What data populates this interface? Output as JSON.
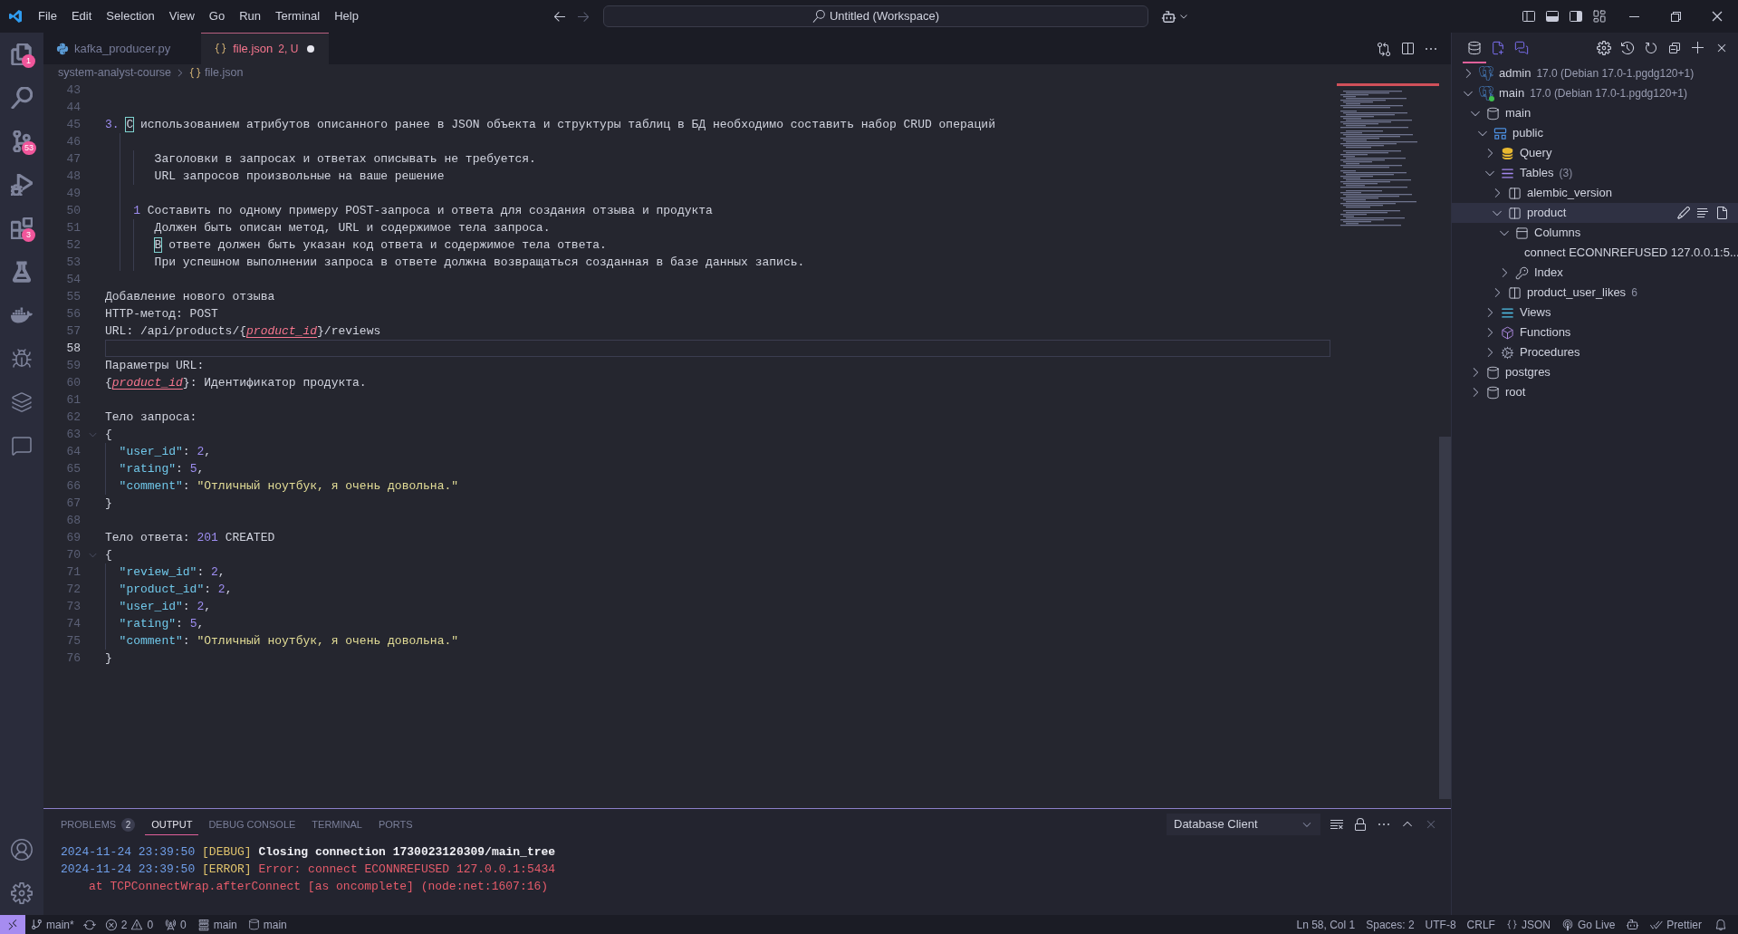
{
  "title_bar": {
    "menu": [
      "File",
      "Edit",
      "Selection",
      "View",
      "Go",
      "Run",
      "Terminal",
      "Help"
    ],
    "command_center": "Untitled (Workspace)"
  },
  "activity_bar": {
    "explorer_badge": "1",
    "source_control_badge": "53",
    "extensions_badge": "3"
  },
  "editor_tabs": [
    {
      "label": "kafka_producer.py",
      "kind": "python",
      "selected": false,
      "has_problems": false,
      "modified": false
    },
    {
      "label": "file.json",
      "kind": "json",
      "status": "2, U",
      "selected": true,
      "has_problems": true,
      "modified": true
    }
  ],
  "breadcrumb": [
    {
      "label": "system-analyst-course",
      "kind": "folder"
    },
    {
      "label": "file.json",
      "kind": "json"
    }
  ],
  "editor": {
    "lines": [
      {
        "number": "43",
        "current": false,
        "fold_marker": false
      },
      {
        "number": "44",
        "current": false,
        "fold_marker": false
      },
      {
        "number": "45",
        "current": false,
        "fold_marker": false,
        "segments": [
          {
            "kind": "number",
            "text": "3. "
          },
          {
            "kind": "highlighted",
            "text": "С"
          },
          {
            "kind": "text",
            "text": " использованием атрибутов описанного ранее в JSON объекта и структуры таблиц в БД необходимо составить набор CRUD операций"
          }
        ]
      },
      {
        "number": "46",
        "current": false,
        "fold_marker": false
      },
      {
        "number": "47",
        "current": false,
        "fold_marker": false,
        "segments": [
          {
            "kind": "text",
            "text": "       Заголовки в запросах и ответах описывать не требуется."
          }
        ]
      },
      {
        "number": "48",
        "current": false,
        "fold_marker": false,
        "segments": [
          {
            "kind": "text",
            "text": "       URL запросов произвольные на ваше решение"
          }
        ]
      },
      {
        "number": "49",
        "current": false,
        "fold_marker": false
      },
      {
        "number": "50",
        "current": false,
        "fold_marker": false,
        "segments": [
          {
            "kind": "number",
            "text": "    1"
          },
          {
            "kind": "text",
            "text": " Составить по одному примеру POST-запроса и ответа для создания отзыва и продукта"
          }
        ]
      },
      {
        "number": "51",
        "current": false,
        "fold_marker": false,
        "segments": [
          {
            "kind": "text",
            "text": "       Должен быть описан метод, URL и содержимое тела запроса."
          }
        ]
      },
      {
        "number": "52",
        "current": false,
        "fold_marker": false,
        "segments": [
          {
            "kind": "highlighted",
            "text": "       В"
          },
          {
            "kind": "text",
            "text": " ответе должен быть указан код ответа и содержимое тела ответа."
          }
        ]
      },
      {
        "number": "53",
        "current": false,
        "fold_marker": false,
        "segments": [
          {
            "kind": "text",
            "text": "       При успешном выполнении запроса в ответе должна возвращаться созданная в базе данных запись."
          }
        ]
      },
      {
        "number": "54",
        "current": false,
        "fold_marker": false
      },
      {
        "number": "55",
        "current": false,
        "fold_marker": false,
        "segments": [
          {
            "kind": "text",
            "text": "Добавление нового отзыва"
          }
        ]
      },
      {
        "number": "56",
        "current": false,
        "fold_marker": false,
        "segments": [
          {
            "kind": "text",
            "text": "HTTP-метод: POST"
          }
        ]
      },
      {
        "number": "57",
        "current": false,
        "fold_marker": false,
        "segments": [
          {
            "kind": "text",
            "text": "URL: /api/products/{"
          },
          {
            "kind": "error",
            "text": "product_id"
          },
          {
            "kind": "text",
            "text": "}/reviews"
          }
        ]
      },
      {
        "number": "58",
        "current": true,
        "fold_marker": false
      },
      {
        "number": "59",
        "current": false,
        "fold_marker": false,
        "segments": [
          {
            "kind": "text",
            "text": "Параметры URL:"
          }
        ]
      },
      {
        "number": "60",
        "current": false,
        "fold_marker": false,
        "segments": [
          {
            "kind": "text",
            "text": "{"
          },
          {
            "kind": "error",
            "text": "product_id"
          },
          {
            "kind": "text",
            "text": "}: Идентификатор продукта."
          }
        ]
      },
      {
        "number": "61",
        "current": false,
        "fold_marker": false
      },
      {
        "number": "62",
        "current": false,
        "fold_marker": false,
        "segments": [
          {
            "kind": "text",
            "text": "Тело запроса:"
          }
        ]
      },
      {
        "number": "63",
        "current": false,
        "fold_marker": true,
        "segments": [
          {
            "kind": "text",
            "text": "{"
          }
        ]
      },
      {
        "number": "64",
        "current": false,
        "fold_marker": false,
        "segments": [
          {
            "kind": "key",
            "text": "  \"user_id\""
          },
          {
            "kind": "text",
            "text": ": "
          },
          {
            "kind": "number",
            "text": "2"
          },
          {
            "kind": "text",
            "text": ","
          }
        ]
      },
      {
        "number": "65",
        "current": false,
        "fold_marker": false,
        "segments": [
          {
            "kind": "key",
            "text": "  \"rating\""
          },
          {
            "kind": "text",
            "text": ": "
          },
          {
            "kind": "number",
            "text": "5"
          },
          {
            "kind": "text",
            "text": ","
          }
        ]
      },
      {
        "number": "66",
        "current": false,
        "fold_marker": false,
        "segments": [
          {
            "kind": "key",
            "text": "  \"comment\""
          },
          {
            "kind": "text",
            "text": ": "
          },
          {
            "kind": "string",
            "text": "\"Отличный ноутбук, я очень довольна.\""
          }
        ]
      },
      {
        "number": "67",
        "current": false,
        "fold_marker": false,
        "segments": [
          {
            "kind": "text",
            "text": "}"
          }
        ]
      },
      {
        "number": "68",
        "current": false,
        "fold_marker": false
      },
      {
        "number": "69",
        "current": false,
        "fold_marker": false,
        "segments": [
          {
            "kind": "text",
            "text": "Тело ответа: "
          },
          {
            "kind": "number",
            "text": "201"
          },
          {
            "kind": "text",
            "text": " CREATED"
          }
        ]
      },
      {
        "number": "70",
        "current": false,
        "fold_marker": true,
        "segments": [
          {
            "kind": "text",
            "text": "{"
          }
        ]
      },
      {
        "number": "71",
        "current": false,
        "fold_marker": false,
        "segments": [
          {
            "kind": "key",
            "text": "  \"review_id\""
          },
          {
            "kind": "text",
            "text": ": "
          },
          {
            "kind": "number",
            "text": "2"
          },
          {
            "kind": "text",
            "text": ","
          }
        ]
      },
      {
        "number": "72",
        "current": false,
        "fold_marker": false,
        "segments": [
          {
            "kind": "key",
            "text": "  \"product_id\""
          },
          {
            "kind": "text",
            "text": ": "
          },
          {
            "kind": "number",
            "text": "2"
          },
          {
            "kind": "text",
            "text": ","
          }
        ]
      },
      {
        "number": "73",
        "current": false,
        "fold_marker": false,
        "segments": [
          {
            "kind": "key",
            "text": "  \"user_id\""
          },
          {
            "kind": "text",
            "text": ": "
          },
          {
            "kind": "number",
            "text": "2"
          },
          {
            "kind": "text",
            "text": ","
          }
        ]
      },
      {
        "number": "74",
        "current": false,
        "fold_marker": false,
        "segments": [
          {
            "kind": "key",
            "text": "  \"rating\""
          },
          {
            "kind": "text",
            "text": ": "
          },
          {
            "kind": "number",
            "text": "5"
          },
          {
            "kind": "text",
            "text": ","
          }
        ]
      },
      {
        "number": "75",
        "current": false,
        "fold_marker": false,
        "segments": [
          {
            "kind": "key",
            "text": "  \"comment\""
          },
          {
            "kind": "text",
            "text": ": "
          },
          {
            "kind": "string",
            "text": "\"Отличный ноутбук, я очень довольна.\""
          }
        ]
      },
      {
        "number": "76",
        "current": false,
        "fold_marker": false,
        "segments": [
          {
            "kind": "text",
            "text": "}"
          }
        ]
      }
    ]
  },
  "panel": {
    "tabs": [
      {
        "label": "PROBLEMS",
        "badge": "2",
        "selected": false
      },
      {
        "label": "OUTPUT",
        "selected": true
      },
      {
        "label": "DEBUG CONSOLE",
        "selected": false
      },
      {
        "label": "TERMINAL",
        "selected": false
      },
      {
        "label": "PORTS",
        "selected": false
      }
    ],
    "channel": "Database Client",
    "output": [
      {
        "kind": "debug",
        "time": "2024-11-24 23:39:50",
        "tag": "[DEBUG]",
        "message": "Closing connection 1730023120309/main_tree"
      },
      {
        "kind": "error",
        "time": "2024-11-24 23:39:50",
        "tag": "[ERROR]",
        "message": "Error: connect ECONNREFUSED 127.0.0.1:5434"
      },
      {
        "kind": "trace",
        "message": "at TCPConnectWrap.afterConnect [as oncomplete] (node:net:1607:16)"
      }
    ]
  },
  "database_panel": {
    "views": [
      {
        "selected": true
      },
      {
        "selected": false
      },
      {
        "selected": false
      }
    ],
    "tree": [
      {
        "label": "admin",
        "detail": "17.0 (Debian 17.0-1.pgdg120+1)",
        "kind": "server",
        "connected": false,
        "expanded": false,
        "selected": false
      },
      {
        "label": "main",
        "detail": "17.0 (Debian 17.0-1.pgdg120+1)",
        "kind": "server",
        "connected": true,
        "expanded": true,
        "selected": false,
        "children": [
          {
            "label": "main",
            "kind": "database",
            "expanded": true,
            "selected": false,
            "children": [
              {
                "label": "public",
                "kind": "schema",
                "expanded": true,
                "selected": false,
                "children": [
                  {
                    "label": "Query",
                    "kind": "query",
                    "expanded": false,
                    "selected": false
                  },
                  {
                    "label": "Tables",
                    "count": "(3)",
                    "kind": "tables",
                    "expanded": true,
                    "selected": false,
                    "children": [
                      {
                        "label": "alembic_version",
                        "kind": "table",
                        "expanded": false,
                        "selected": false
                      },
                      {
                        "label": "product",
                        "kind": "table",
                        "expanded": true,
                        "selected": true,
                        "children": [
                          {
                            "label": "Columns",
                            "kind": "columns",
                            "expanded": true,
                            "selected": false,
                            "children": [
                              {
                                "label": "connect ECONNREFUSED 127.0.0.1:5...",
                                "kind": "message",
                                "selected": false
                              }
                            ]
                          },
                          {
                            "label": "Index",
                            "kind": "index",
                            "expanded": false,
                            "selected": false
                          }
                        ]
                      },
                      {
                        "label": "product_user_likes",
                        "count": "6",
                        "kind": "table",
                        "expanded": false,
                        "selected": false
                      }
                    ]
                  },
                  {
                    "label": "Views",
                    "kind": "views",
                    "expanded": false,
                    "selected": false
                  },
                  {
                    "label": "Functions",
                    "kind": "functions",
                    "expanded": false,
                    "selected": false
                  },
                  {
                    "label": "Procedures",
                    "kind": "procedures",
                    "expanded": false,
                    "selected": false
                  }
                ]
              }
            ]
          },
          {
            "label": "postgres",
            "kind": "database",
            "expanded": false,
            "selected": false
          },
          {
            "label": "root",
            "kind": "database",
            "expanded": false,
            "selected": false
          }
        ]
      }
    ]
  },
  "status_bar": {
    "left": [
      {
        "kind": "remote"
      },
      {
        "kind": "branch",
        "label": "main*"
      },
      {
        "kind": "sync"
      },
      {
        "kind": "problems",
        "errors": "2",
        "warnings": "0"
      },
      {
        "kind": "ports",
        "label": "0"
      },
      {
        "kind": "connection",
        "label": "main"
      },
      {
        "kind": "database",
        "label": "main"
      }
    ],
    "right": [
      {
        "kind": "cursor",
        "label": "Ln 58, Col 1"
      },
      {
        "kind": "indent",
        "label": "Spaces: 2"
      },
      {
        "kind": "encoding",
        "label": "UTF-8"
      },
      {
        "kind": "eol",
        "label": "CRLF"
      },
      {
        "kind": "language",
        "label": "JSON"
      },
      {
        "kind": "live",
        "label": "Go Live"
      },
      {
        "kind": "assistant"
      },
      {
        "kind": "formatter",
        "label": "Prettier"
      },
      {
        "kind": "notifications"
      }
    ]
  }
}
